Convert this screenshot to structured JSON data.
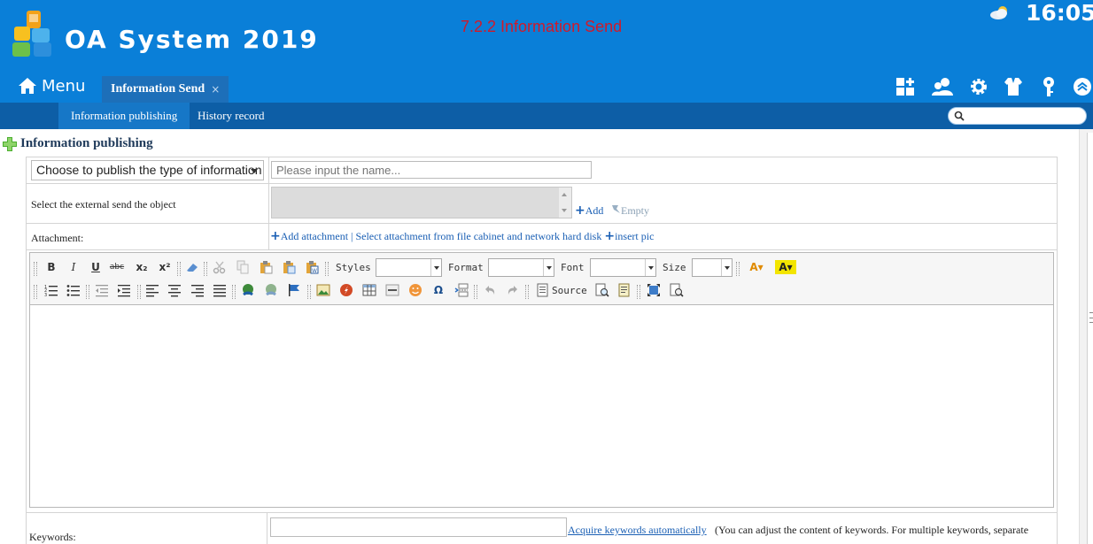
{
  "app": {
    "title": "OA System 2019",
    "page_heading": "7.2.2 Information Send",
    "clock": "16:05"
  },
  "nav": {
    "menu_label": "Menu",
    "active_tab": "Information Send",
    "tab_close": "×",
    "sub_tabs": [
      "Information publishing",
      "History record"
    ],
    "search_placeholder": ""
  },
  "toolbar_icons": [
    "grid-plus-icon",
    "users-icon",
    "settings-icon",
    "shirt-icon",
    "key-icon",
    "collapse-up-icon"
  ],
  "form": {
    "section_title": "Information publishing",
    "type_select": "Choose to publish the type of information",
    "name_placeholder": "Please input the name...",
    "external_label": "Select the external send the object",
    "add_label": "Add",
    "empty_label": "Empty",
    "attachment_label": "Attachment:",
    "add_attachment": "Add attachment",
    "select_attachment": "Select attachment from file cabinet and network hard disk",
    "insert_pic": "insert pic",
    "keywords_label": "Keywords:",
    "keywords_value": "",
    "acquire_keywords": "Acquire keywords automatically",
    "keywords_note": "(You can adjust the content of keywords. For multiple keywords, separate"
  },
  "editor": {
    "styles_label": "Styles",
    "format_label": "Format",
    "font_label": "Font",
    "size_label": "Size",
    "source_label": "Source",
    "bold": "B",
    "italic": "I",
    "underline": "U",
    "strike": "abc",
    "subscript": "x₂",
    "superscript": "x²",
    "omega": "Ω"
  },
  "colors": {
    "header_bg": "#0a7fd8",
    "subnav_bg": "#0d5ea6",
    "heading_red": "#d01a2a",
    "link_blue": "#1a5fb4"
  }
}
